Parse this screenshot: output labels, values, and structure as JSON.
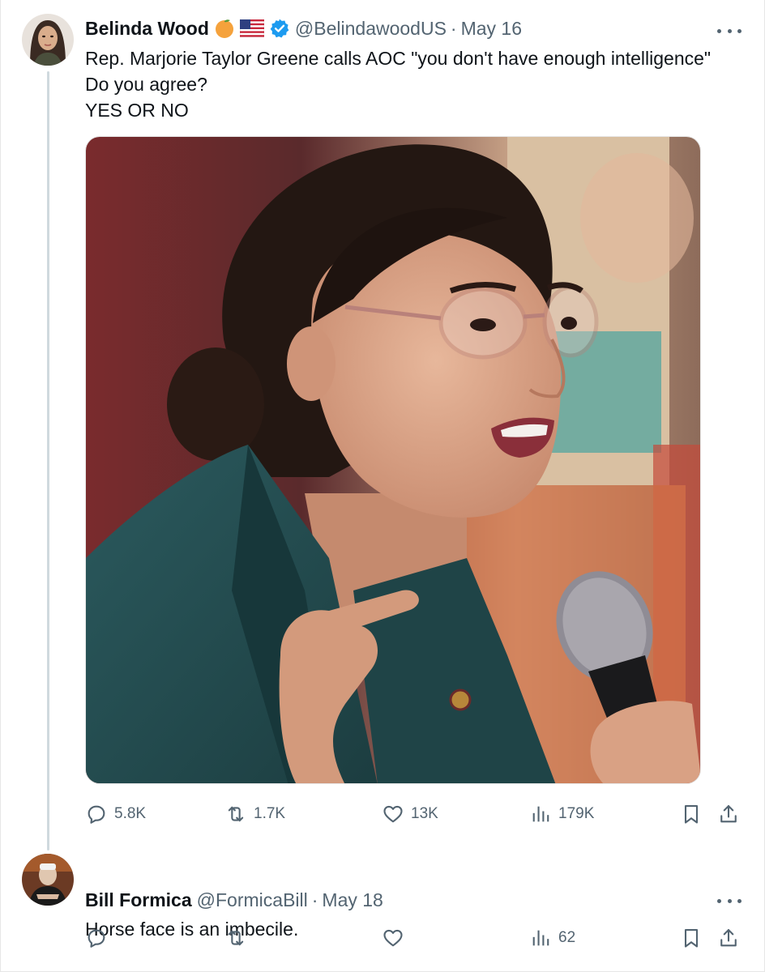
{
  "main_tweet": {
    "author": {
      "name": "Belinda Wood",
      "handle": "@BelindawoodUS",
      "badges": [
        "orange-emoji",
        "us-flag-emoji",
        "verified-badge"
      ],
      "verified_color": "#1d9bf0"
    },
    "separator": "·",
    "date": "May 16",
    "text_lines": [
      "Rep. Marjorie Taylor Greene calls AOC \"you don't have enough intelligence\"",
      "Do you agree?",
      "YES OR NO"
    ],
    "media": {
      "kind": "photo"
    },
    "stats": {
      "replies": "5.8K",
      "reposts": "1.7K",
      "likes": "13K",
      "views": "179K"
    }
  },
  "reply_tweet": {
    "author": {
      "name": "Bill Formica",
      "handle": "@FormicaBill"
    },
    "separator": "·",
    "date": "May 18",
    "text": "Horse face is an imbecile.",
    "stats": {
      "views": "62"
    }
  },
  "icons": {
    "more": "more-horizontal-icon",
    "reply": "reply-bubble-icon",
    "repost": "repost-arrows-icon",
    "like": "heart-icon",
    "views": "bar-chart-icon",
    "bookmark": "bookmark-icon",
    "share": "share-upload-icon"
  },
  "colors": {
    "text_primary": "#0f1419",
    "text_secondary": "#536471",
    "thread_line": "#cfd9de",
    "accent": "#1d9bf0"
  }
}
